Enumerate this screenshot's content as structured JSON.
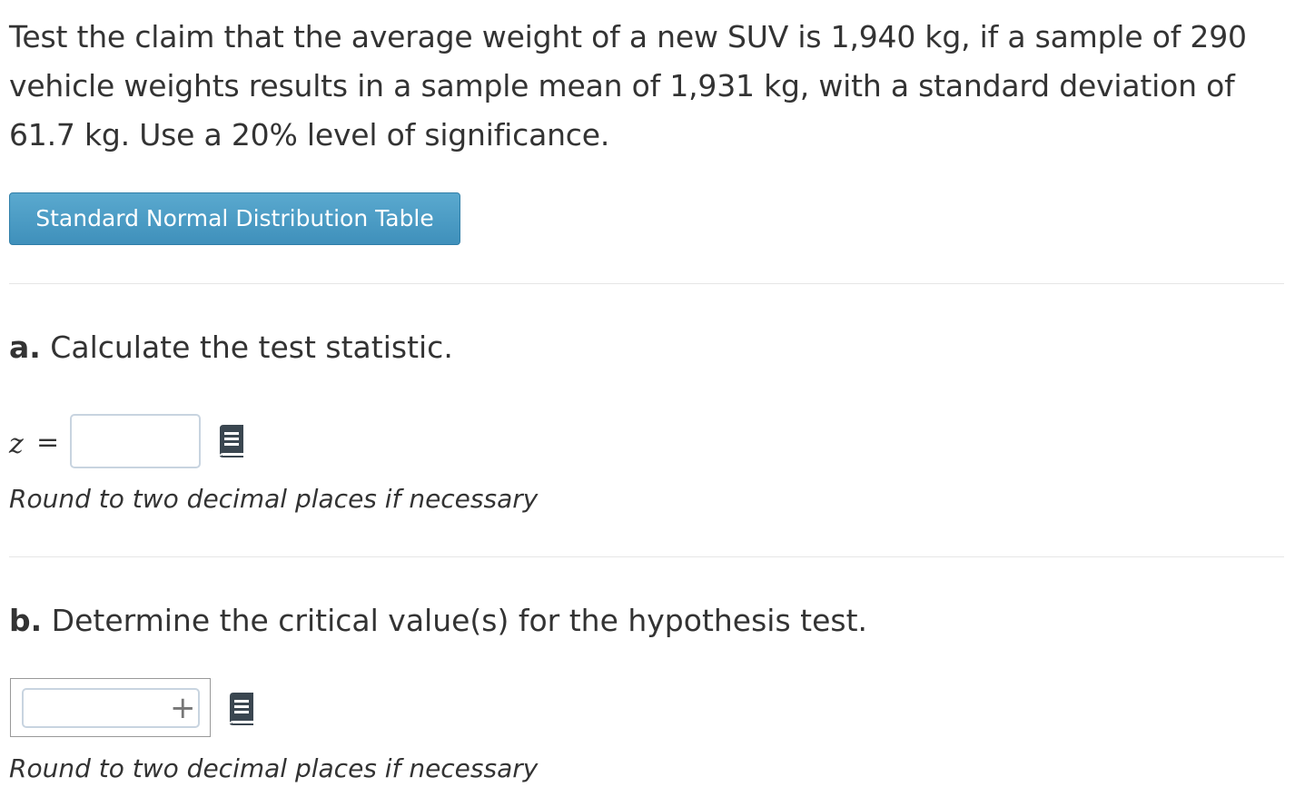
{
  "problem": {
    "text": "Test the claim that the average weight of a new SUV is 1,940 kg, if a sample of 290 vehicle weights results in a sample mean of 1,931 kg, with a standard deviation of 61.7 kg. Use a 20% level of significance."
  },
  "table_button": {
    "label": "Standard Normal Distribution Table"
  },
  "part_a": {
    "letter": "a.",
    "prompt": " Calculate the test statistic.",
    "variable": "z",
    "equals": "=",
    "input_value": "",
    "hint": "Round to two decimal places if necessary",
    "icon": "book-icon"
  },
  "part_b": {
    "letter": "b.",
    "prompt": " Determine the critical value(s) for the hypothesis test.",
    "input_value": "",
    "add_symbol": "+",
    "icon": "book-icon",
    "hint_partial": "Round to two decimal places if necessary"
  },
  "colors": {
    "button_top": "#5aa9cf",
    "button_bottom": "#3f90bb",
    "text": "#333333",
    "icon": "#3a4650",
    "input_border": "#c8d4e0"
  }
}
